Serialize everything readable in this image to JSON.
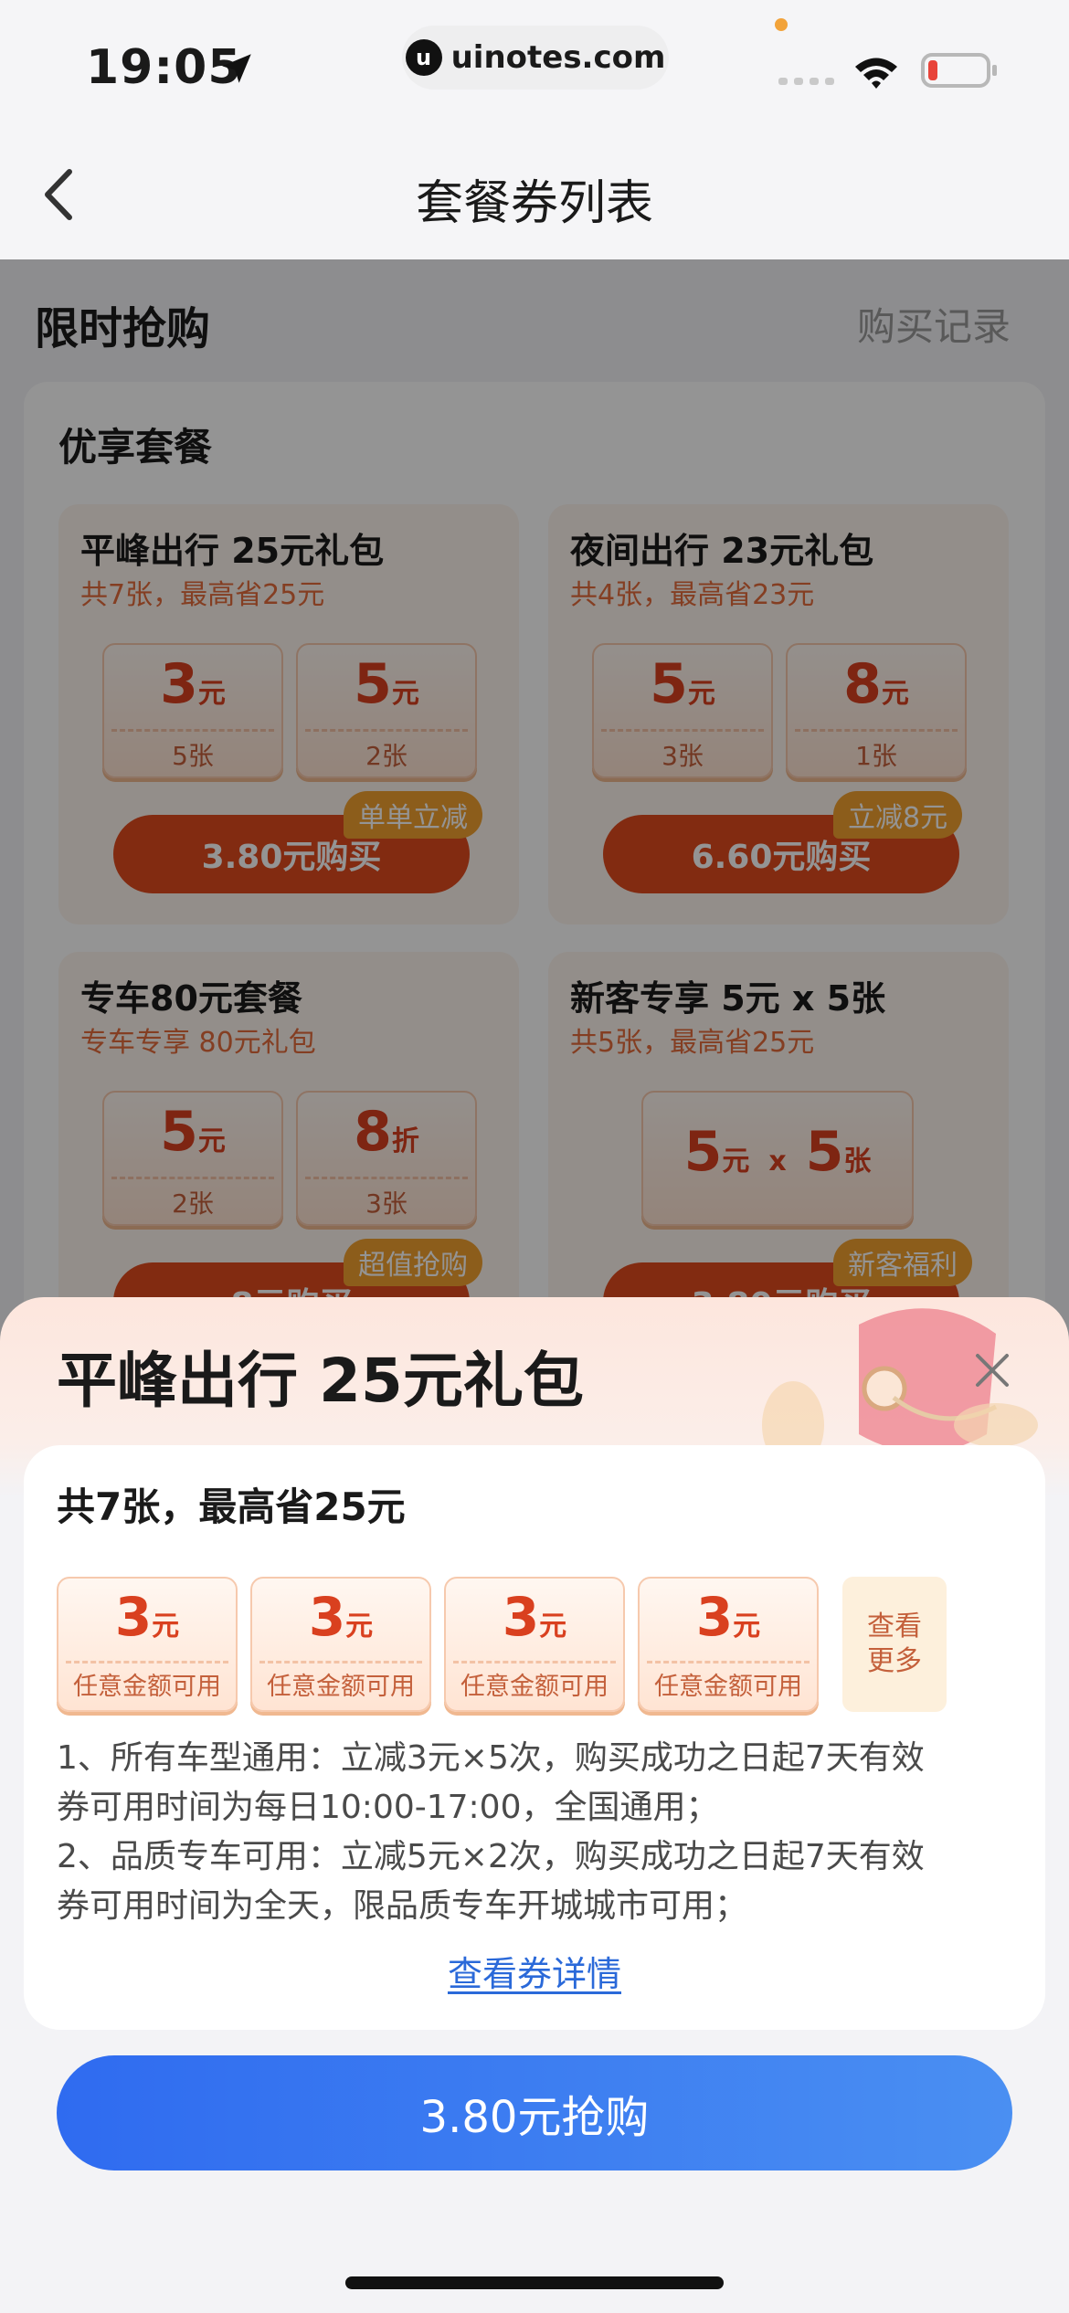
{
  "status_bar": {
    "time": "19:05",
    "url": "uinotes.com",
    "url_logo_letter": "u"
  },
  "nav": {
    "title": "套餐券列表",
    "back_icon": "chevron-left-icon"
  },
  "flash_sale": {
    "title": "限时抢购",
    "record_link": "购买记录"
  },
  "package_section": {
    "title": "优享套餐",
    "bundles": [
      {
        "title": "平峰出行 25元礼包",
        "subtitle": "共7张，最高省25元",
        "tickets": [
          {
            "value": "3",
            "unit": "元",
            "count": "5张"
          },
          {
            "value": "5",
            "unit": "元",
            "count": "2张"
          }
        ],
        "button": "3.80元购买",
        "tag": "单单立减"
      },
      {
        "title": "夜间出行 23元礼包",
        "subtitle": "共4张，最高省23元",
        "tickets": [
          {
            "value": "5",
            "unit": "元",
            "count": "3张"
          },
          {
            "value": "8",
            "unit": "元",
            "count": "1张"
          }
        ],
        "button": "6.60元购买",
        "tag": "立减8元"
      },
      {
        "title": "专车80元套餐",
        "subtitle": "专车专享 80元礼包",
        "tickets": [
          {
            "value": "5",
            "unit": "元",
            "count": "2张"
          },
          {
            "value": "8",
            "unit": "折",
            "count": "3张"
          }
        ],
        "button": "8元购买",
        "tag": "超值抢购"
      },
      {
        "title": "新客专享 5元 x 5张",
        "subtitle": "共5张，最高省25元",
        "wide_ticket": {
          "value1": "5",
          "unit1": "元",
          "times": "x",
          "value2": "5",
          "unit2": "张"
        },
        "button": "3.80元购买",
        "tag": "新客福利"
      }
    ]
  },
  "sheet": {
    "title": "平峰出行 25元礼包",
    "close_icon": "close-icon",
    "summary": "共7张，最高省25元",
    "coupons": [
      {
        "value": "3",
        "unit": "元",
        "note": "任意金额可用"
      },
      {
        "value": "3",
        "unit": "元",
        "note": "任意金额可用"
      },
      {
        "value": "3",
        "unit": "元",
        "note": "任意金额可用"
      },
      {
        "value": "3",
        "unit": "元",
        "note": "任意金额可用"
      }
    ],
    "more_line1": "查看",
    "more_line2": "更多",
    "rules": [
      "1、所有车型通用：立减3元×5次，购买成功之日起7天有效",
      "券可用时间为每日10:00-17:00，全国通用；",
      "2、品质专车可用：立减5元×2次，购买成功之日起7天有效",
      "券可用时间为全天，限品质专车开城城市可用；"
    ],
    "detail_link": "查看券详情",
    "cta": "3.80元抢购"
  },
  "colors": {
    "accent_blue": "#2f6bf0",
    "coupon_red": "#d9401f",
    "button_orange": "#e04a1e",
    "tag_gold": "#f1a02f",
    "link_blue": "#2a69d9"
  }
}
